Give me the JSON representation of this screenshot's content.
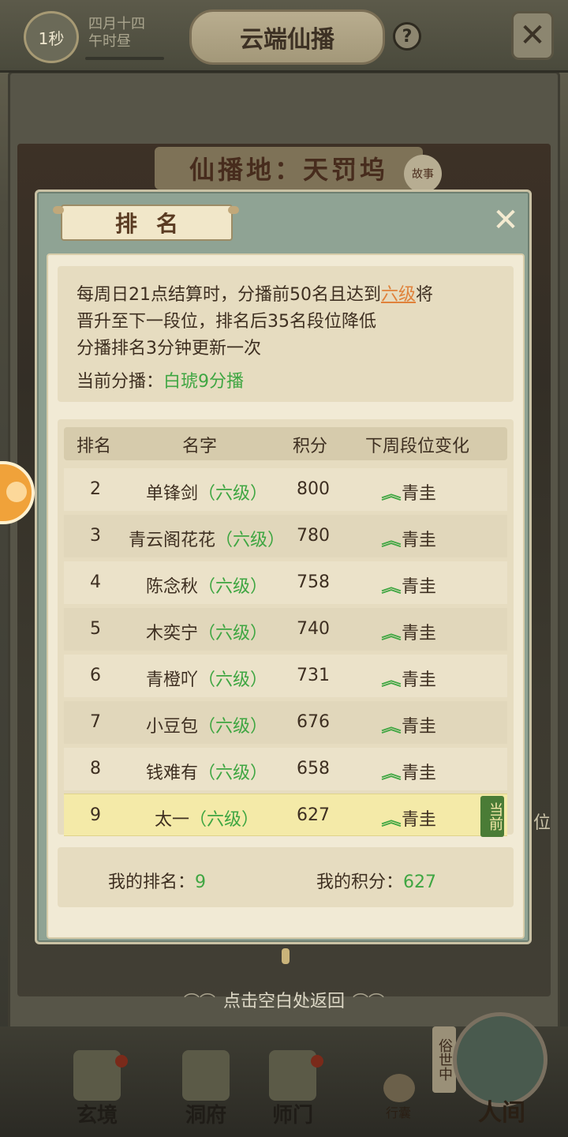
{
  "header": {
    "timer": "1秒",
    "date_line1": "四月十四",
    "date_line2": "午时昼",
    "title": "云端仙播",
    "help": "?",
    "close": "✕"
  },
  "scene": {
    "place_title": "仙播地：天罚坞",
    "story_tag": "故事",
    "side_text": "位"
  },
  "modal": {
    "title": "排名",
    "close": "✕",
    "info": {
      "line1_prefix": "每周日21点结算时，分播前50名且达到",
      "line1_link": "六级",
      "line1_suffix": "将",
      "line2": "晋升至下一段位，排名后35名段位降低",
      "line3": "分播排名3分钟更新一次",
      "current_label": "当前分播：",
      "current_value": "白琥9分播"
    },
    "table": {
      "headers": {
        "rank": "排名",
        "name": "名字",
        "score": "积分",
        "change": "下周段位变化"
      },
      "rows": [
        {
          "rank": "2",
          "name": "单锋剑",
          "tier": "（六级）",
          "score": "800",
          "change": "青圭"
        },
        {
          "rank": "3",
          "name": "青云阁花花",
          "tier": "（六级）",
          "score": "780",
          "change": "青圭"
        },
        {
          "rank": "4",
          "name": "陈念秋",
          "tier": "（六级）",
          "score": "758",
          "change": "青圭"
        },
        {
          "rank": "5",
          "name": "木奕宁",
          "tier": "（六级）",
          "score": "740",
          "change": "青圭"
        },
        {
          "rank": "6",
          "name": "青橙吖",
          "tier": "（六级）",
          "score": "731",
          "change": "青圭"
        },
        {
          "rank": "7",
          "name": "小豆包",
          "tier": "（六级）",
          "score": "676",
          "change": "青圭"
        },
        {
          "rank": "8",
          "name": "钱难有",
          "tier": "（六级）",
          "score": "658",
          "change": "青圭"
        },
        {
          "rank": "9",
          "name": "太一",
          "tier": "（六级）",
          "score": "627",
          "change": "青圭",
          "tag": "当前"
        }
      ]
    },
    "mine": {
      "rank_label": "我的排名：",
      "rank_value": "9",
      "score_label": "我的积分：",
      "score_value": "627"
    }
  },
  "return_hint": "点击空白处返回",
  "nav": {
    "items": [
      "玄境",
      "洞府",
      "师门"
    ],
    "bag": "行囊",
    "world_side": "俗世中",
    "world": "人间"
  },
  "colors": {
    "accent_green": "#3fa642",
    "link_orange": "#e0823b",
    "parchment": "#f1ead5"
  }
}
